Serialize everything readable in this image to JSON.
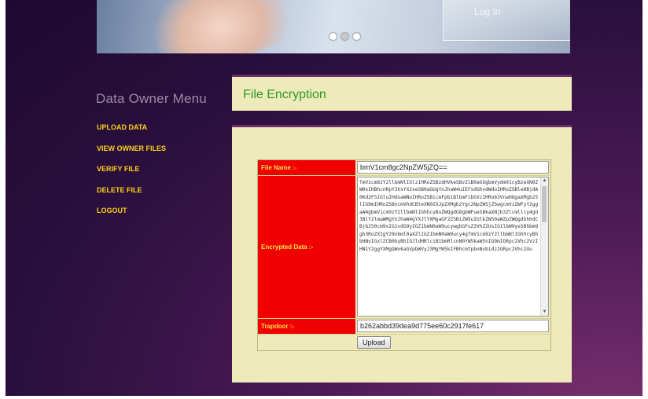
{
  "banner": {
    "card_text": "Log In",
    "slides": 3,
    "active_slide": 1
  },
  "sidebar": {
    "title": "Data Owner  Menu",
    "items": [
      {
        "label": "UPLOAD DATA"
      },
      {
        "label": "VIEW OWNER FILES"
      },
      {
        "label": "VERIFY FILE"
      },
      {
        "label": "DELETE FILE"
      },
      {
        "label": "LOGOUT"
      }
    ]
  },
  "main": {
    "title": "File Encryption",
    "form": {
      "file_name_label": "File Name :-",
      "file_name_value": "bmV1cm8gc2NpZW5jZQ==",
      "encrypted_label": "Encrypted Data :-",
      "encrypted_value": "TmV1cm8zY2llbmNlIGlzIHRoZSBzdHVkeSBvZiB0aGUgbmVydm91cyBzeXN0ZW0sIHBhcnRpY3VsYXJseSB0aGUgYnJhaW4uIEFsdGhvdWdoIHRoZSBleHBjdA0Kd2F5IGluIHdoaWNoIHRoZSBicmFpbiBlbmFibGVzIHRob3VnaHQgaXMgb25lIG9mIHRoZSBncmVhdCBteXN0ZXJpZXMgb2Ygc2NpZW5jZSwgcmVzZWFyY2ggaW4gbmV1cm9zY2llbmNlIGhhcyBsZWQgdG8gbWFueSBkaXNjb3Zlcmllcy4gU3BlY2lmaWMgYnJhaW4gYXJlYXMgaGF2ZSBiZWVuIGlkZW50aWZpZWQgdGhhdCBjb250cm9sIG1vdG9yIGZ1bmN0aW9ucywgbGFuZ3VhZ2UsIG1lbW9yeSBhbmQgb3RoZXIgY29nbml0aXZlIGZ1bmN0aW9ucy4gTmV1cm9zY2llbmNlIGhhcyBhbHNvIGxlZCB0byBhIGJldHRlciB1bmRlcnN0YW5kaW5nIG9mIGRpc2Vhc2VzIHN1Y2ggYXMgQWx6aGVpbWVyJ3MgYW5kIFBhcmtpbnNvbidzIGRpc2Vhc2Uu",
      "trapdoor_label": "Trapdoor :-",
      "trapdoor_value": "b262abbd39dea9d775ee60c2917fe617",
      "upload_label": "Upload"
    }
  },
  "colors": {
    "label_bg": "#f00000",
    "label_text": "#ffe24a",
    "panel_bg": "#efeab9",
    "menu_text": "#ffd21a",
    "title_text": "#2a9a2a"
  }
}
